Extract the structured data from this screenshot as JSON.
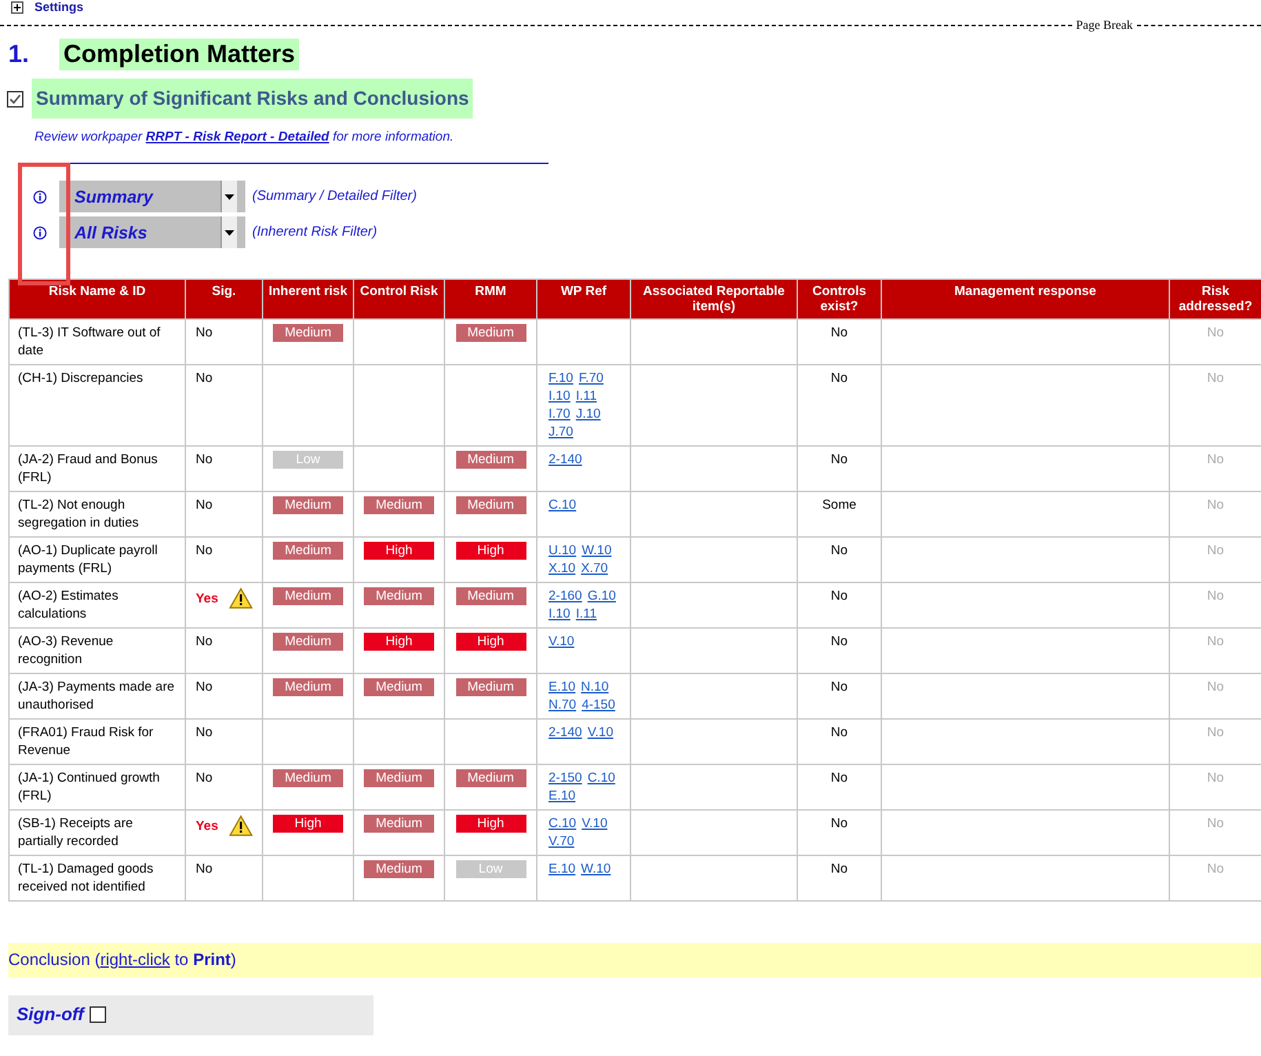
{
  "settings_link": {
    "label": "Settings"
  },
  "page_break": {
    "label": "Page Break"
  },
  "section": {
    "number": "1.",
    "title": "Completion Matters"
  },
  "subsection": {
    "checked": true,
    "title": "Summary of Significant Risks and Conclusions"
  },
  "review_note": {
    "prefix": "Review workpaper ",
    "link": "RRPT - Risk Report - Detailed",
    "suffix": " for more information."
  },
  "filters": [
    {
      "value": "Summary",
      "hint": "(Summary / Detailed Filter)"
    },
    {
      "value": "All Risks",
      "hint": "(Inherent Risk Filter)"
    }
  ],
  "table": {
    "columns": [
      "Risk Name & ID",
      "Sig.",
      "Inherent risk",
      "Control Risk",
      "RMM",
      "WP Ref",
      "Associated Reportable item(s)",
      "Controls exist?",
      "Management response",
      "Risk addressed?"
    ],
    "rows": [
      {
        "risk": "(TL-3) IT Software out of date",
        "sig": "No",
        "significant": false,
        "inherent": {
          "label": "Medium",
          "kind": "medium"
        },
        "control": null,
        "rmm": {
          "label": "Medium",
          "kind": "medium"
        },
        "wp_refs": [],
        "controls_exist": "No",
        "risk_addressed": "No"
      },
      {
        "risk": "(CH-1) Discrepancies",
        "sig": "No",
        "significant": false,
        "inherent": null,
        "control": null,
        "rmm": null,
        "wp_refs": [
          "F.10",
          "F.70",
          "I.10",
          "I.11",
          "I.70",
          "J.10",
          "J.70"
        ],
        "controls_exist": "No",
        "risk_addressed": "No"
      },
      {
        "risk": "(JA-2) Fraud and Bonus (FRL)",
        "sig": "No",
        "significant": false,
        "inherent": {
          "label": "Low",
          "kind": "low"
        },
        "control": null,
        "rmm": {
          "label": "Medium",
          "kind": "medium"
        },
        "wp_refs": [
          "2-140"
        ],
        "controls_exist": "No",
        "risk_addressed": "No"
      },
      {
        "risk": "(TL-2) Not enough segregation in duties",
        "sig": "No",
        "significant": false,
        "inherent": {
          "label": "Medium",
          "kind": "medium"
        },
        "control": {
          "label": "Medium",
          "kind": "medium"
        },
        "rmm": {
          "label": "Medium",
          "kind": "medium"
        },
        "wp_refs": [
          "C.10"
        ],
        "controls_exist": "Some",
        "risk_addressed": "No"
      },
      {
        "risk": "(AO-1) Duplicate payroll payments (FRL)",
        "sig": "No",
        "significant": false,
        "inherent": {
          "label": "Medium",
          "kind": "medium"
        },
        "control": {
          "label": "High",
          "kind": "high"
        },
        "rmm": {
          "label": "High",
          "kind": "high"
        },
        "wp_refs": [
          "U.10",
          "W.10",
          "X.10",
          "X.70"
        ],
        "controls_exist": "No",
        "risk_addressed": "No"
      },
      {
        "risk": "(AO-2) Estimates calculations",
        "sig": "Yes",
        "significant": true,
        "inherent": {
          "label": "Medium",
          "kind": "medium"
        },
        "control": {
          "label": "Medium",
          "kind": "medium"
        },
        "rmm": {
          "label": "Medium",
          "kind": "medium"
        },
        "wp_refs": [
          "2-160",
          "G.10",
          "I.10",
          "I.11"
        ],
        "controls_exist": "No",
        "risk_addressed": "No"
      },
      {
        "risk": "(AO-3) Revenue recognition",
        "sig": "No",
        "significant": false,
        "inherent": {
          "label": "Medium",
          "kind": "medium"
        },
        "control": {
          "label": "High",
          "kind": "high"
        },
        "rmm": {
          "label": "High",
          "kind": "high"
        },
        "wp_refs": [
          "V.10"
        ],
        "controls_exist": "No",
        "risk_addressed": "No"
      },
      {
        "risk": "(JA-3) Payments made are unauthorised",
        "sig": "No",
        "significant": false,
        "inherent": {
          "label": "Medium",
          "kind": "medium"
        },
        "control": {
          "label": "Medium",
          "kind": "medium"
        },
        "rmm": {
          "label": "Medium",
          "kind": "medium"
        },
        "wp_refs": [
          "E.10",
          "N.10",
          "N.70",
          "4-150"
        ],
        "controls_exist": "No",
        "risk_addressed": "No"
      },
      {
        "risk": "(FRA01) Fraud Risk for Revenue",
        "sig": "No",
        "significant": false,
        "inherent": null,
        "control": null,
        "rmm": null,
        "wp_refs": [
          "2-140",
          "V.10"
        ],
        "controls_exist": "No",
        "risk_addressed": "No"
      },
      {
        "risk": "(JA-1) Continued growth (FRL)",
        "sig": "No",
        "significant": false,
        "inherent": {
          "label": "Medium",
          "kind": "medium"
        },
        "control": {
          "label": "Medium",
          "kind": "medium"
        },
        "rmm": {
          "label": "Medium",
          "kind": "medium"
        },
        "wp_refs": [
          "2-150",
          "C.10",
          "E.10"
        ],
        "controls_exist": "No",
        "risk_addressed": "No"
      },
      {
        "risk": "(SB-1) Receipts are partially recorded",
        "sig": "Yes",
        "significant": true,
        "inherent": {
          "label": "High",
          "kind": "high"
        },
        "control": {
          "label": "Medium",
          "kind": "medium"
        },
        "rmm": {
          "label": "High",
          "kind": "high"
        },
        "wp_refs": [
          "C.10",
          "V.10",
          "V.70"
        ],
        "controls_exist": "No",
        "risk_addressed": "No"
      },
      {
        "risk": "(TL-1) Damaged goods received not identified",
        "sig": "No",
        "significant": false,
        "inherent": null,
        "control": {
          "label": "Medium",
          "kind": "medium"
        },
        "rmm": {
          "label": "Low",
          "kind": "low"
        },
        "wp_refs": [
          "E.10",
          "W.10"
        ],
        "controls_exist": "No",
        "risk_addressed": "No"
      }
    ]
  },
  "conclusion": {
    "prefix": "Conclusion (",
    "link": "right-click",
    "suffix": " to **Print**)"
  },
  "sign_off": {
    "label": "Sign-off",
    "checked": false
  }
}
